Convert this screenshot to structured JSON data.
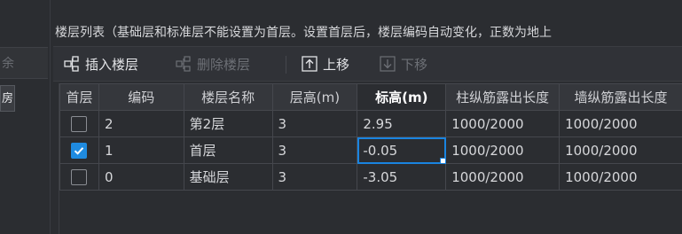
{
  "left_panel": {
    "delete_label": "余",
    "item_label": "房"
  },
  "header": {
    "text": "楼层列表（基础层和标准层不能设置为首层。设置首层后，楼层编码自动变化，正数为地上"
  },
  "toolbar": {
    "insert_label": "插入楼层",
    "delete_label": "删除楼层",
    "move_up_label": "上移",
    "move_down_label": "下移"
  },
  "table": {
    "columns": [
      "首层",
      "编码",
      "楼层名称",
      "层高(m)",
      "标高(m)",
      "柱纵筋露出长度",
      "墙纵筋露出长度"
    ],
    "rows": [
      {
        "first_floor": false,
        "code": "2",
        "name": "第2层",
        "height": "3",
        "elevation": "2.95",
        "col_rebar": "1000/2000",
        "wall_rebar": "1000/2000"
      },
      {
        "first_floor": true,
        "code": "1",
        "name": "首层",
        "height": "3",
        "elevation": "-0.05",
        "col_rebar": "1000/2000",
        "wall_rebar": "1000/2000"
      },
      {
        "first_floor": false,
        "code": "0",
        "name": "基础层",
        "height": "3",
        "elevation": "-3.05",
        "col_rebar": "1000/2000",
        "wall_rebar": "1000/2000"
      }
    ]
  },
  "colors": {
    "accent": "#1f8be0",
    "background": "#2b2d31"
  }
}
